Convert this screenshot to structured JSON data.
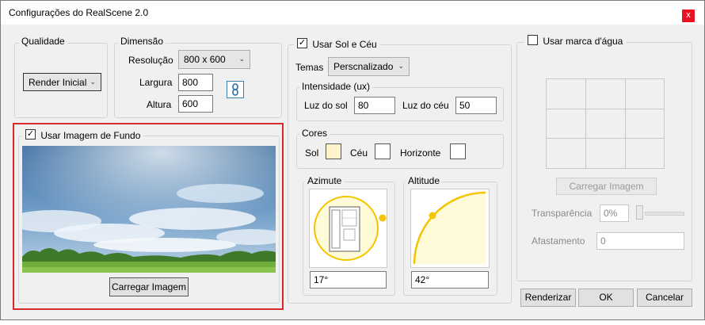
{
  "window": {
    "title": "Configurações do RealScene 2.0",
    "close_glyph": "x"
  },
  "qualidade": {
    "legend": "Qualidade",
    "select_value": "Render Inicial"
  },
  "dimensao": {
    "legend": "Dimensão",
    "resolucao_label": "Resolução",
    "resolucao_value": "800 x 600",
    "largura_label": "Largura",
    "largura_value": "800",
    "altura_label": "Altura",
    "altura_value": "600",
    "lock_icon": "chain-link-icon"
  },
  "fundo": {
    "checkbox_label": "Usar Imagem de Fundo",
    "checked": true,
    "load_button": "Carregar Imagem"
  },
  "sol": {
    "checkbox_label": "Usar Sol e Céu",
    "checked": true,
    "temas_label": "Temas",
    "temas_value": "Perscnalizado",
    "intensidade_legend": "Intensidade (ux)",
    "luz_sol_label": "Luz do sol",
    "luz_sol_value": "80",
    "luz_ceu_label": "Luz do céu",
    "luz_ceu_value": "50",
    "cores_legend": "Cores",
    "cor_sol_label": "Sol",
    "cor_sol": "#fff3c9",
    "cor_ceu_label": "Céu",
    "cor_ceu": "#ffffff",
    "cor_horizonte_label": "Horizonte",
    "cor_horizonte": "#ffffff",
    "azimute_legend": "Azimute",
    "azimute_value": "17°",
    "altitude_legend": "Altitude",
    "altitude_value": "42°",
    "accent": "#f2c500"
  },
  "marca": {
    "checkbox_label": "Usar marca d'água",
    "checked": false,
    "load_button": "Carregar Imagem",
    "transparencia_label": "Transparência",
    "transparencia_value": "0%",
    "afastamento_label": "Afastamento",
    "afastamento_value": "0"
  },
  "footer": {
    "render_button": "Renderizar",
    "ok_button": "OK",
    "cancel_button": "Cancelar"
  },
  "colors": {
    "highlight_border": "#d42a2a"
  }
}
